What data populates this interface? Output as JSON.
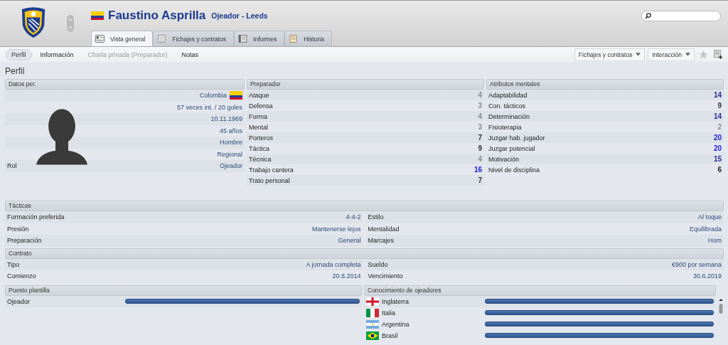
{
  "header": {
    "name": "Faustino Asprilla",
    "subtitle": "Ojeador - Leeds"
  },
  "tabs": [
    {
      "label": "Vista general",
      "selected": true
    },
    {
      "label": "Fichajes y contratos",
      "selected": false
    },
    {
      "label": "Informes",
      "selected": false
    },
    {
      "label": "Historia",
      "selected": false
    }
  ],
  "subnav": [
    {
      "label": "Perfil",
      "selected": true,
      "disabled": false
    },
    {
      "label": "Información",
      "selected": false,
      "disabled": false
    },
    {
      "label": "Charla privada (Preparador)",
      "selected": false,
      "disabled": true
    },
    {
      "label": "Notas",
      "selected": false,
      "disabled": false
    }
  ],
  "actions": [
    "Fichajes y contratos",
    "Interacción"
  ],
  "page_title": "Perfil",
  "personal": {
    "title": "Datos per.",
    "rows": [
      {
        "label": "",
        "value": "Colombia"
      },
      {
        "label": "",
        "value": "57 veces int. / 20 goles"
      },
      {
        "label": "",
        "value": "10.11.1969"
      },
      {
        "label": "",
        "value": "45 años"
      },
      {
        "label": "",
        "value": "Hombre"
      },
      {
        "label": "",
        "value": "Regional"
      },
      {
        "label": "Rol",
        "value": "Ojeador"
      }
    ]
  },
  "coach": {
    "title": "Preparador",
    "rows": [
      {
        "label": "Ataque",
        "value": "4",
        "color": "#8a8a8a"
      },
      {
        "label": "Defensa",
        "value": "3",
        "color": "#8a8a8a"
      },
      {
        "label": "Forma",
        "value": "4",
        "color": "#8a8a8a"
      },
      {
        "label": "Mental",
        "value": "3",
        "color": "#8a8a8a"
      },
      {
        "label": "Porteros",
        "value": "7",
        "color": "#333333"
      },
      {
        "label": "Táctica",
        "value": "9",
        "color": "#333333"
      },
      {
        "label": "Técnica",
        "value": "4",
        "color": "#8a8a8a"
      },
      {
        "label": "Trabajo cantera",
        "value": "16",
        "color": "#1a1ad8"
      },
      {
        "label": "Trato personal",
        "value": "7",
        "color": "#333333"
      }
    ]
  },
  "mental": {
    "title": "Atributos mentales",
    "rows": [
      {
        "label": "Adaptabilidad",
        "value": "14",
        "color": "#2a2a9a"
      },
      {
        "label": "Con. tácticos",
        "value": "9",
        "color": "#333333"
      },
      {
        "label": "Determinación",
        "value": "14",
        "color": "#2a2a9a"
      },
      {
        "label": "Fisioterapia",
        "value": "2",
        "color": "#8a8a8a"
      },
      {
        "label": "Juzgar hab. jugador",
        "value": "20",
        "color": "#1a1ad8"
      },
      {
        "label": "Juzgar potencial",
        "value": "20",
        "color": "#1a1ad8"
      },
      {
        "label": "Motivación",
        "value": "15",
        "color": "#2a2a9a"
      },
      {
        "label": "Nivel de disciplina",
        "value": "6",
        "color": "#222222"
      }
    ]
  },
  "tactics": {
    "title": "Tácticas",
    "rows": [
      [
        {
          "label": "Formación preferida",
          "value": "4-4-2"
        },
        {
          "label": "Estilo",
          "value": "Al toque"
        }
      ],
      [
        {
          "label": "Presión",
          "value": "Mantenerse lejos"
        },
        {
          "label": "Mentalidad",
          "value": "Equilibrada"
        }
      ],
      [
        {
          "label": "Preparación",
          "value": "General"
        },
        {
          "label": "Marcajes",
          "value": "Hom"
        }
      ]
    ]
  },
  "contract": {
    "title": "Contrato",
    "rows": [
      [
        {
          "label": "Tipo",
          "value": "A jornada completa"
        },
        {
          "label": "Sueldo",
          "value": "€900 por semana"
        }
      ],
      [
        {
          "label": "Comienzo",
          "value": "20.8.2014"
        },
        {
          "label": "Vencimiento",
          "value": "30.6.2019"
        }
      ]
    ]
  },
  "squad_role": {
    "title": "Puesto plantilla",
    "rows": [
      {
        "label": "Ojeador",
        "level": 1
      }
    ]
  },
  "knowledge": {
    "title": "Conocimiento de ojeadores",
    "rows": [
      {
        "label": "Inglaterra",
        "level": 1
      },
      {
        "label": "Italia",
        "level": 1
      },
      {
        "label": "Argentina",
        "level": 1
      },
      {
        "label": "Brasil",
        "level": 1
      }
    ]
  }
}
